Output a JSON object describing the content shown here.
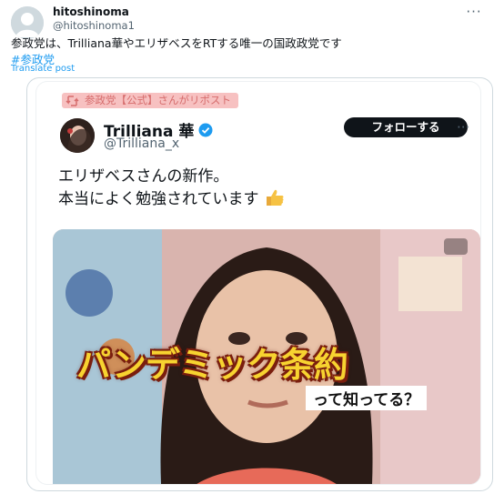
{
  "post": {
    "author_name": "hitoshinoma",
    "author_handle": "@hitoshinoma1",
    "text": "参政党は、Trilliana華やエリザベスをRTする唯一の国政政党です",
    "hashtag": "#参政党",
    "translate_label": "Translate post",
    "more_label": "···"
  },
  "embedded": {
    "repost_banner": "参政党【公式】さんがリポスト",
    "name": "Trilliana 華",
    "handle": "@Trilliana_x",
    "follow_label": "フォローする",
    "more_label": "···",
    "text_line1": "エリザベスさんの新作。",
    "text_line2": "本当によく勉強されています",
    "video_title": "パンデミック条約",
    "video_subtitle": "って知ってる？"
  },
  "colors": {
    "link": "#1d9bf0",
    "verified": "#1d9bf0",
    "banner_bg": "#f7c1c1",
    "banner_text": "#d66c6c",
    "follow_bg": "#0f1419",
    "video_title": "#f7d330"
  },
  "icons": [
    "avatar-placeholder",
    "more-icon",
    "repost-icon",
    "verified-badge-icon",
    "thumbs-up-icon",
    "video-badge-icon"
  ]
}
